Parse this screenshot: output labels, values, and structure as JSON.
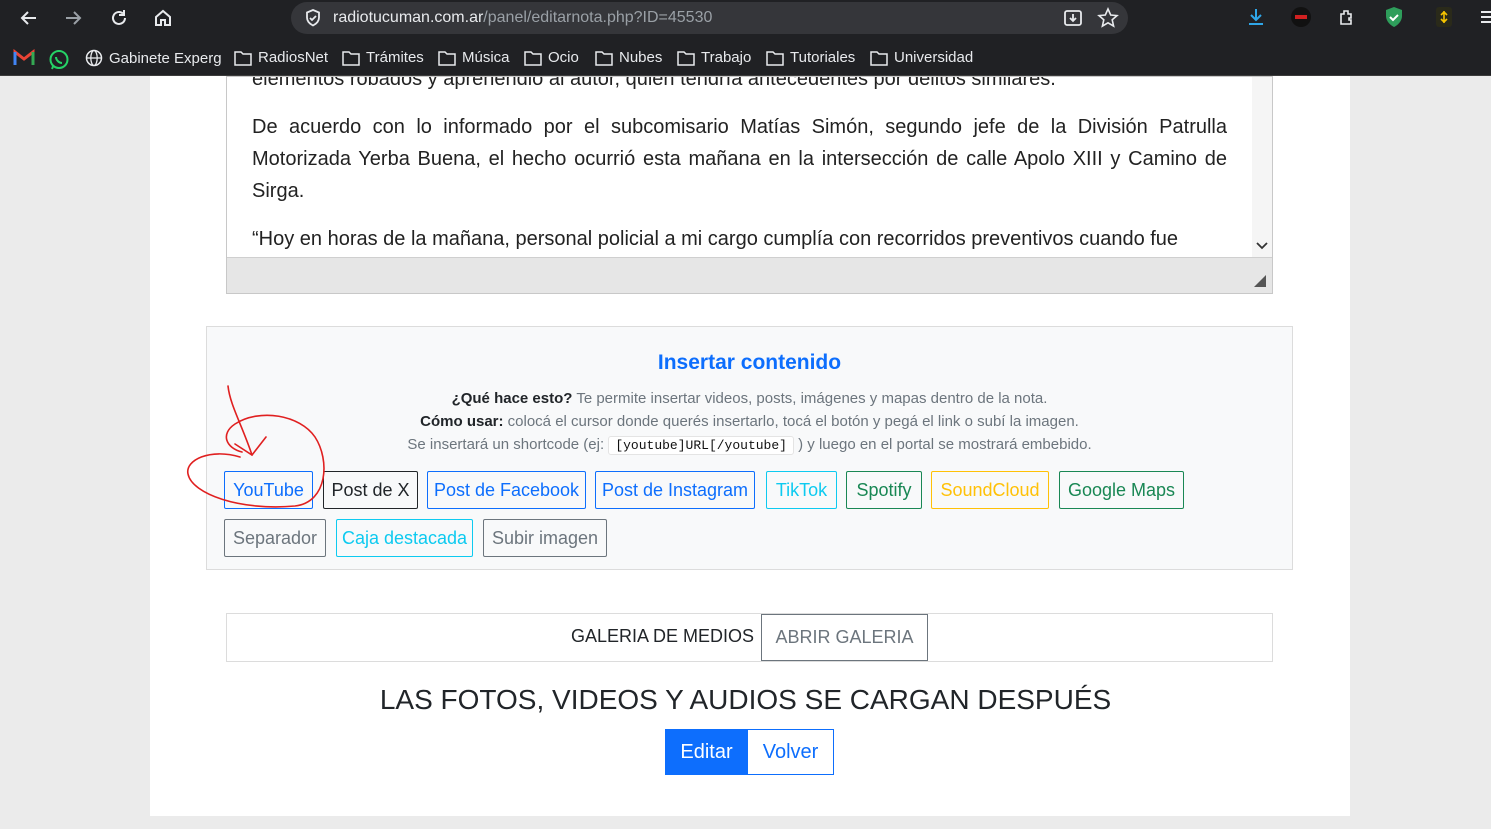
{
  "browser": {
    "url_host": "radiotucuman.com.ar",
    "url_path": "/panel/editarnota.php?ID=45530"
  },
  "bookmarks": [
    {
      "label": "Gabinete Experg",
      "icon": "globe-icon"
    },
    {
      "label": "RadiosNet",
      "icon": "folder-icon"
    },
    {
      "label": "Trámites",
      "icon": "folder-icon"
    },
    {
      "label": "Música",
      "icon": "folder-icon"
    },
    {
      "label": "Ocio",
      "icon": "folder-icon"
    },
    {
      "label": "Nubes",
      "icon": "folder-icon"
    },
    {
      "label": "Trabajo",
      "icon": "folder-icon"
    },
    {
      "label": "Tutoriales",
      "icon": "folder-icon"
    },
    {
      "label": "Universidad",
      "icon": "folder-icon"
    }
  ],
  "editor": {
    "paragraphs": [
      "elementos robados y aprehendió al autor, quien tendría antecedentes por delitos similares.",
      "De acuerdo con lo informado por el subcomisario Matías Simón, segundo jefe de la División Patrulla Motorizada Yerba Buena, el hecho ocurrió esta mañana en la intersección de calle Apolo XIII y Camino de Sirga.",
      "“Hoy en horas de la mañana, personal policial a mi cargo cumplía con recorridos preventivos cuando fue"
    ]
  },
  "insert": {
    "title": "Insertar contenido",
    "what_label": "¿Qué hace esto?",
    "what_text": " Te permite insertar videos, posts, imágenes y mapas dentro de la nota.",
    "how_label": "Cómo usar:",
    "how_text": " colocá el cursor donde querés insertarlo, tocá el botón y pegá el link o subí la imagen.",
    "shortcode_before": "Se insertará un shortcode (ej: ",
    "shortcode_example": "[youtube]URL[/youtube]",
    "shortcode_after": " ) y luego en el portal se mostrará embebido.",
    "buttons": {
      "youtube": "YouTube",
      "x": "Post de X",
      "facebook": "Post de Facebook",
      "instagram": "Post de Instagram",
      "tiktok": "TikTok",
      "spotify": "Spotify",
      "soundcloud": "SoundCloud",
      "maps": "Google Maps",
      "separator": "Separador",
      "highlight": "Caja destacada",
      "upload": "Subir imagen"
    }
  },
  "gallery": {
    "label": "GALERIA DE MEDIOS",
    "button": "ABRIR GALERIA"
  },
  "notice": "LAS FOTOS, VIDEOS Y AUDIOS SE CARGAN DESPUÉS",
  "actions": {
    "edit": "Editar",
    "back": "Volver"
  },
  "colors": {
    "primary": "#0d6efd",
    "info": "#0dcaf0",
    "success": "#198754",
    "warning": "#ffc107",
    "secondary": "#6c757d",
    "dark": "#212529",
    "annotation": "#e02020"
  }
}
